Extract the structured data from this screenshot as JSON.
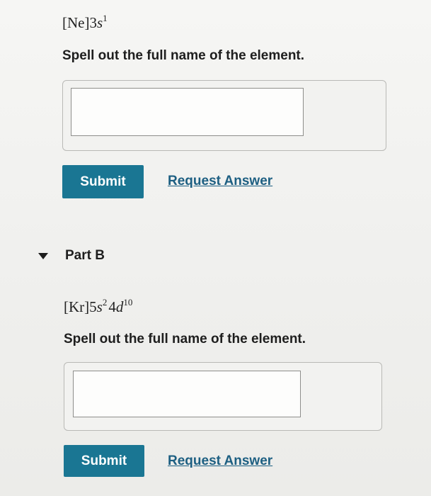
{
  "part_a": {
    "formula": {
      "core": "[Ne]",
      "coef": "3",
      "orbital": "s",
      "exp": "1"
    },
    "prompt": "Spell out the full name of the element.",
    "input_value": "",
    "submit_label": "Submit",
    "request_label": "Request Answer"
  },
  "part_b": {
    "title": "Part B",
    "formula": {
      "core": "[Kr]",
      "coef1": "5",
      "orbital1": "s",
      "exp1": "2",
      "coef2": "4",
      "orbital2": "d",
      "exp2": "10"
    },
    "prompt": "Spell out the full name of the element.",
    "input_value": "",
    "submit_label": "Submit",
    "request_label": "Request Answer"
  },
  "icons": {
    "part_b_toggle": "caret-down-icon"
  }
}
